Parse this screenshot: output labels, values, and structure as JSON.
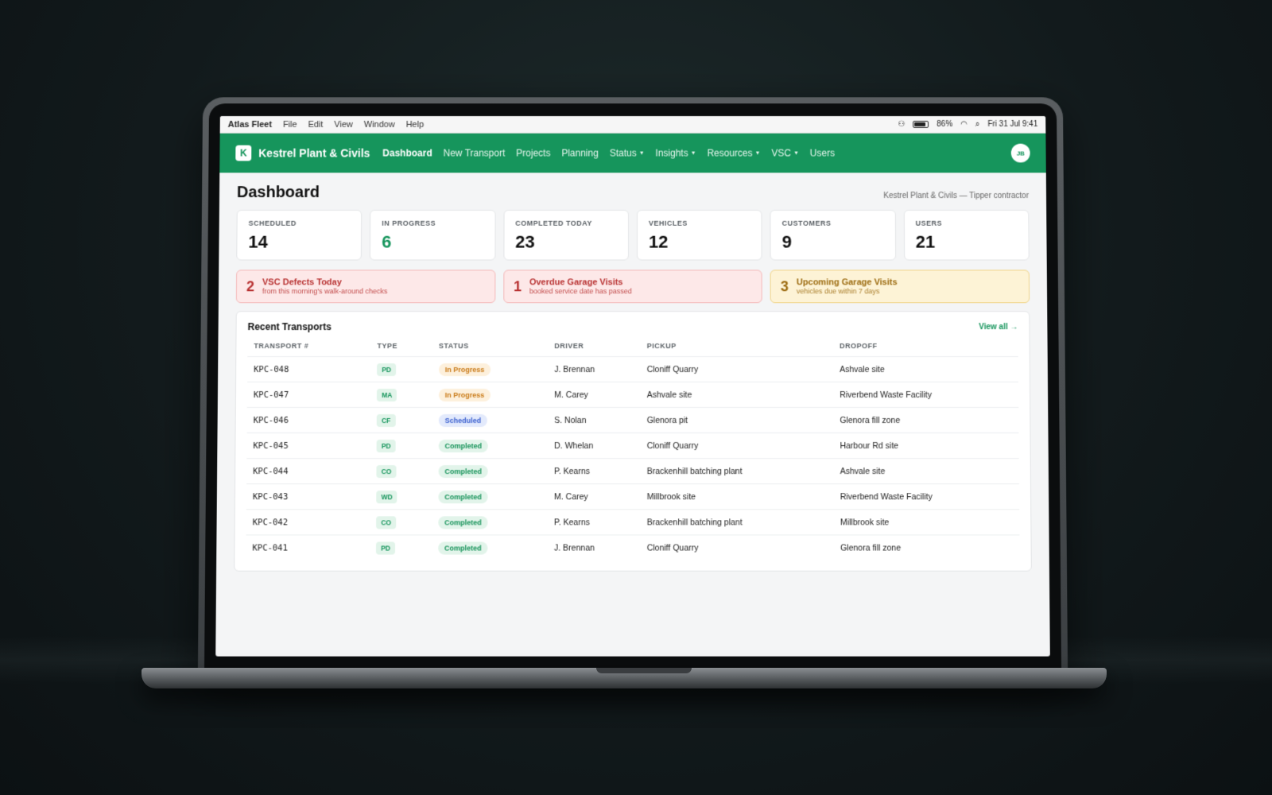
{
  "menubar": {
    "app": "Atlas Fleet",
    "menus": [
      "File",
      "Edit",
      "View",
      "Window",
      "Help"
    ],
    "battery_pct": "86%",
    "battery_level": 0.86,
    "datetime": "Fri 31 Jul  9:41"
  },
  "navbar": {
    "logo_letter": "K",
    "brand": "Kestrel Plant & Civils",
    "items": [
      {
        "label": "Dashboard",
        "active": true,
        "dropdown": false
      },
      {
        "label": "New Transport",
        "active": false,
        "dropdown": false
      },
      {
        "label": "Projects",
        "active": false,
        "dropdown": false
      },
      {
        "label": "Planning",
        "active": false,
        "dropdown": false
      },
      {
        "label": "Status",
        "active": false,
        "dropdown": true
      },
      {
        "label": "Insights",
        "active": false,
        "dropdown": true
      },
      {
        "label": "Resources",
        "active": false,
        "dropdown": true
      },
      {
        "label": "VSC",
        "active": false,
        "dropdown": true
      },
      {
        "label": "Users",
        "active": false,
        "dropdown": false
      }
    ],
    "avatar": "JB",
    "accent": "#16955c"
  },
  "page": {
    "title": "Dashboard",
    "tenant": "Kestrel Plant & Civils — Tipper contractor"
  },
  "stats": [
    {
      "label": "SCHEDULED",
      "value": "14",
      "highlight": false
    },
    {
      "label": "IN PROGRESS",
      "value": "6",
      "highlight": true
    },
    {
      "label": "COMPLETED TODAY",
      "value": "23",
      "highlight": false
    },
    {
      "label": "VEHICLES",
      "value": "12",
      "highlight": false
    },
    {
      "label": "CUSTOMERS",
      "value": "9",
      "highlight": false
    },
    {
      "label": "USERS",
      "value": "21",
      "highlight": false
    }
  ],
  "alerts": [
    {
      "count": "2",
      "title": "VSC Defects Today",
      "sub": "from this morning's walk-around checks",
      "tone": "red"
    },
    {
      "count": "1",
      "title": "Overdue Garage Visits",
      "sub": "booked service date has passed",
      "tone": "red"
    },
    {
      "count": "3",
      "title": "Upcoming Garage Visits",
      "sub": "vehicles due within 7 days",
      "tone": "amber"
    }
  ],
  "transports": {
    "title": "Recent Transports",
    "view_all": "View all →",
    "columns": [
      "TRANSPORT #",
      "TYPE",
      "STATUS",
      "DRIVER",
      "PICKUP",
      "DROPOFF"
    ],
    "rows": [
      {
        "id": "KPC-048",
        "type": "PD",
        "status": "In Progress",
        "driver": "J. Brennan",
        "pickup": "Cloniff Quarry",
        "dropoff": "Ashvale site"
      },
      {
        "id": "KPC-047",
        "type": "MA",
        "status": "In Progress",
        "driver": "M. Carey",
        "pickup": "Ashvale site",
        "dropoff": "Riverbend Waste Facility"
      },
      {
        "id": "KPC-046",
        "type": "CF",
        "status": "Scheduled",
        "driver": "S. Nolan",
        "pickup": "Glenora pit",
        "dropoff": "Glenora fill zone"
      },
      {
        "id": "KPC-045",
        "type": "PD",
        "status": "Completed",
        "driver": "D. Whelan",
        "pickup": "Cloniff Quarry",
        "dropoff": "Harbour Rd site"
      },
      {
        "id": "KPC-044",
        "type": "CO",
        "status": "Completed",
        "driver": "P. Kearns",
        "pickup": "Brackenhill batching plant",
        "dropoff": "Ashvale site"
      },
      {
        "id": "KPC-043",
        "type": "WD",
        "status": "Completed",
        "driver": "M. Carey",
        "pickup": "Millbrook site",
        "dropoff": "Riverbend Waste Facility"
      },
      {
        "id": "KPC-042",
        "type": "CO",
        "status": "Completed",
        "driver": "P. Kearns",
        "pickup": "Brackenhill batching plant",
        "dropoff": "Millbrook site"
      },
      {
        "id": "KPC-041",
        "type": "PD",
        "status": "Completed",
        "driver": "J. Brennan",
        "pickup": "Cloniff Quarry",
        "dropoff": "Glenora fill zone"
      }
    ]
  }
}
